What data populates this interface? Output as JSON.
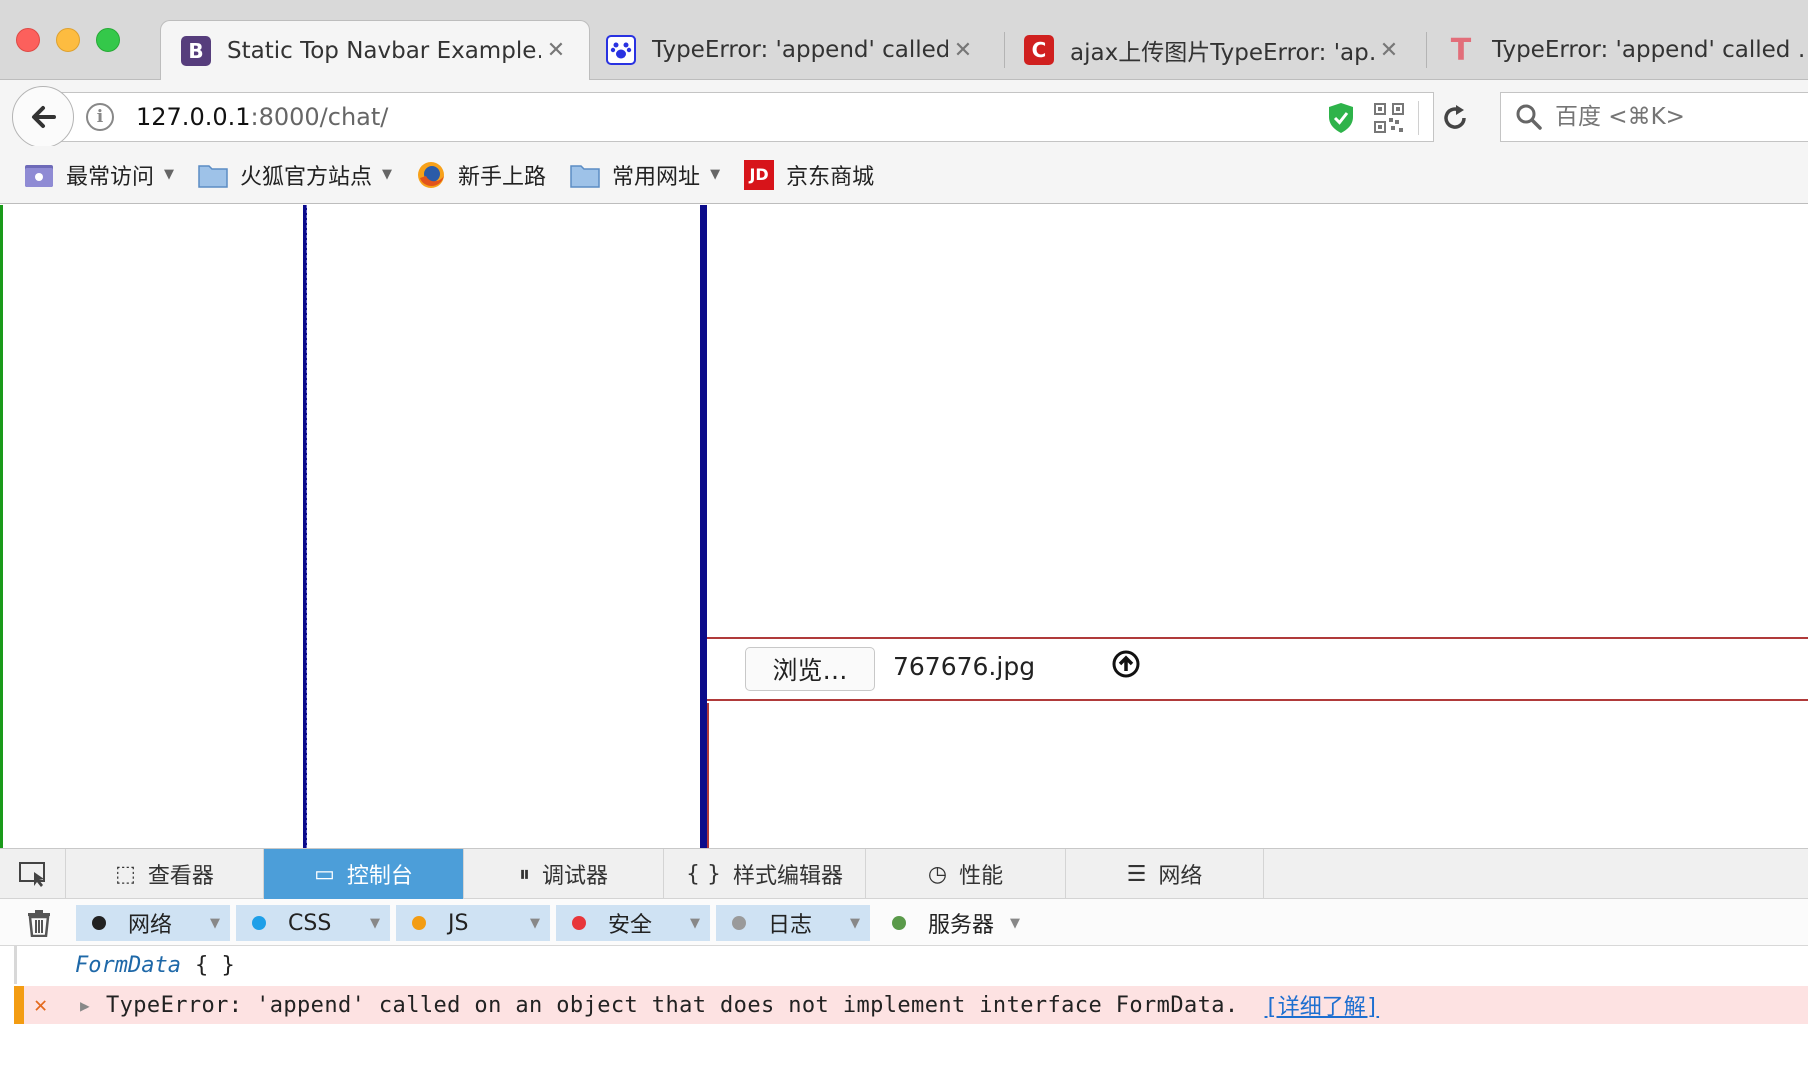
{
  "browser": {
    "tabs": [
      {
        "title": "Static Top Navbar Example…",
        "icon": "bootstrap-icon",
        "active": true
      },
      {
        "title": "TypeError: 'append' called …",
        "icon": "baidu-paw-icon",
        "active": false
      },
      {
        "title": "ajax上传图片TypeError: 'ap…",
        "icon": "csdn-icon",
        "active": false
      },
      {
        "title": "TypeError: 'append' called …",
        "icon": "t-logo-icon",
        "active": false
      }
    ],
    "close_glyph": "✕",
    "url_host": "127.0.0.1",
    "url_rest": ":8000/chat/",
    "search_placeholder": "百度 <⌘K>"
  },
  "bookmarks": [
    {
      "label": "最常访问",
      "dropdown": true,
      "icon": "folder-gear-icon"
    },
    {
      "label": "火狐官方站点",
      "dropdown": true,
      "icon": "folder-icon"
    },
    {
      "label": "新手上路",
      "dropdown": false,
      "icon": "firefox-icon"
    },
    {
      "label": "常用网址",
      "dropdown": true,
      "icon": "folder-icon"
    },
    {
      "label": "京东商城",
      "dropdown": false,
      "icon": "jd-icon"
    }
  ],
  "page": {
    "browse_label": "浏览…",
    "file_name": "767676.jpg"
  },
  "devtools": {
    "tabs": [
      {
        "label": "查看器",
        "icon": "inspector-icon",
        "glyph": "⬚",
        "selected": false
      },
      {
        "label": "控制台",
        "icon": "console-icon",
        "glyph": "▭",
        "selected": true
      },
      {
        "label": "调试器",
        "icon": "debugger-icon",
        "glyph": "⏸",
        "selected": false
      },
      {
        "label": "样式编辑器",
        "icon": "style-editor-icon",
        "glyph": "{ }",
        "selected": false
      },
      {
        "label": "性能",
        "icon": "performance-icon",
        "glyph": "◷",
        "selected": false
      },
      {
        "label": "网络",
        "icon": "network-icon",
        "glyph": "☰",
        "selected": false
      }
    ],
    "filters": [
      {
        "label": "网络",
        "color": "#222222",
        "on": true
      },
      {
        "label": "CSS",
        "color": "#1e9fe8",
        "on": true
      },
      {
        "label": "JS",
        "color": "#f39c12",
        "on": true
      },
      {
        "label": "安全",
        "color": "#e8363a",
        "on": true
      },
      {
        "label": "日志",
        "color": "#9a9a9a",
        "on": true
      },
      {
        "label": "服务器",
        "color": "#5a9a4a",
        "on": false
      }
    ],
    "console": {
      "log_name": "FormData",
      "log_value": "{  }",
      "error_icon": "✕",
      "error_message": "TypeError: 'append' called on an object that does not implement interface FormData.",
      "error_link": "[详细了解]"
    }
  },
  "colors": {
    "accent": "#4c9ed9",
    "error_bg": "#fde2e2",
    "error_bar": "#f39c12",
    "frame_blue": "#0b0b8a",
    "frame_green": "#1a9a1a",
    "frame_red": "#b03a3a"
  }
}
